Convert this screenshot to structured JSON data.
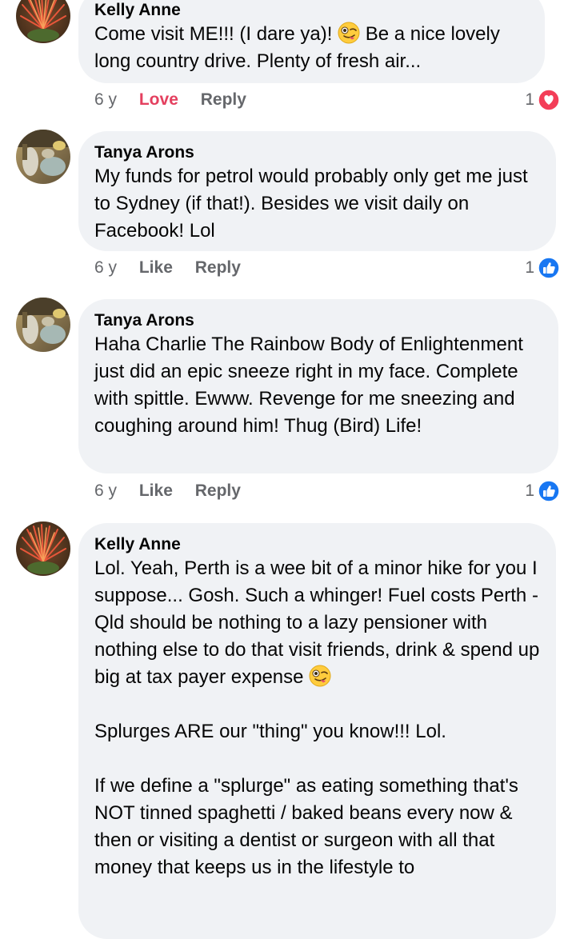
{
  "comments": [
    {
      "author": "Kelly Anne",
      "text_before_emoji": "Come visit ME!!! (I dare ya)! ",
      "text_after_emoji": " Be a nice lovely long country drive. Plenty of fresh air...",
      "emoji": "winking-tongue-emoji",
      "time": "6 y",
      "action_react": "Love",
      "action_reply": "Reply",
      "reaction_count": "1",
      "reaction_icon": "heart-icon"
    },
    {
      "author": "Tanya Arons",
      "text": "My funds for petrol would probably only get me just to Sydney (if that!). Besides we visit daily on Facebook! Lol",
      "time": "6 y",
      "action_react": "Like",
      "action_reply": "Reply",
      "reaction_count": "1",
      "reaction_icon": "thumbs-up-icon"
    },
    {
      "author": "Tanya Arons",
      "text": "Haha Charlie The Rainbow Body of Enlightenment just did an epic sneeze right in my face. Complete with spittle.  Ewww.  Revenge for me sneezing and coughing around him! Thug (Bird) Life!",
      "time": "6 y",
      "action_react": "Like",
      "action_reply": "Reply",
      "reaction_count": "1",
      "reaction_icon": "thumbs-up-icon"
    },
    {
      "author": "Kelly Anne",
      "text_before_emoji": "Lol. Yeah, Perth is a wee bit of a minor hike for you I suppose... Gosh. Such a whinger! Fuel costs Perth - Qld should be nothing to a lazy pensioner with nothing else to do that visit friends, drink & spend up big at tax payer expense ",
      "emoji": "winking-tongue-emoji",
      "paragraph_2": "Splurges ARE our \"thing\" you know!!! Lol.",
      "paragraph_3": "If we define a \"splurge\" as eating something that's NOT tinned spaghetti / baked beans every now & then or visiting a dentist or surgeon with all that money that keeps us in the lifestyle to"
    }
  ],
  "colors": {
    "bubble_bg": "#f0f2f5",
    "meta_text": "#65676b",
    "love": "#e4405f",
    "like_blue": "#1877f2"
  }
}
